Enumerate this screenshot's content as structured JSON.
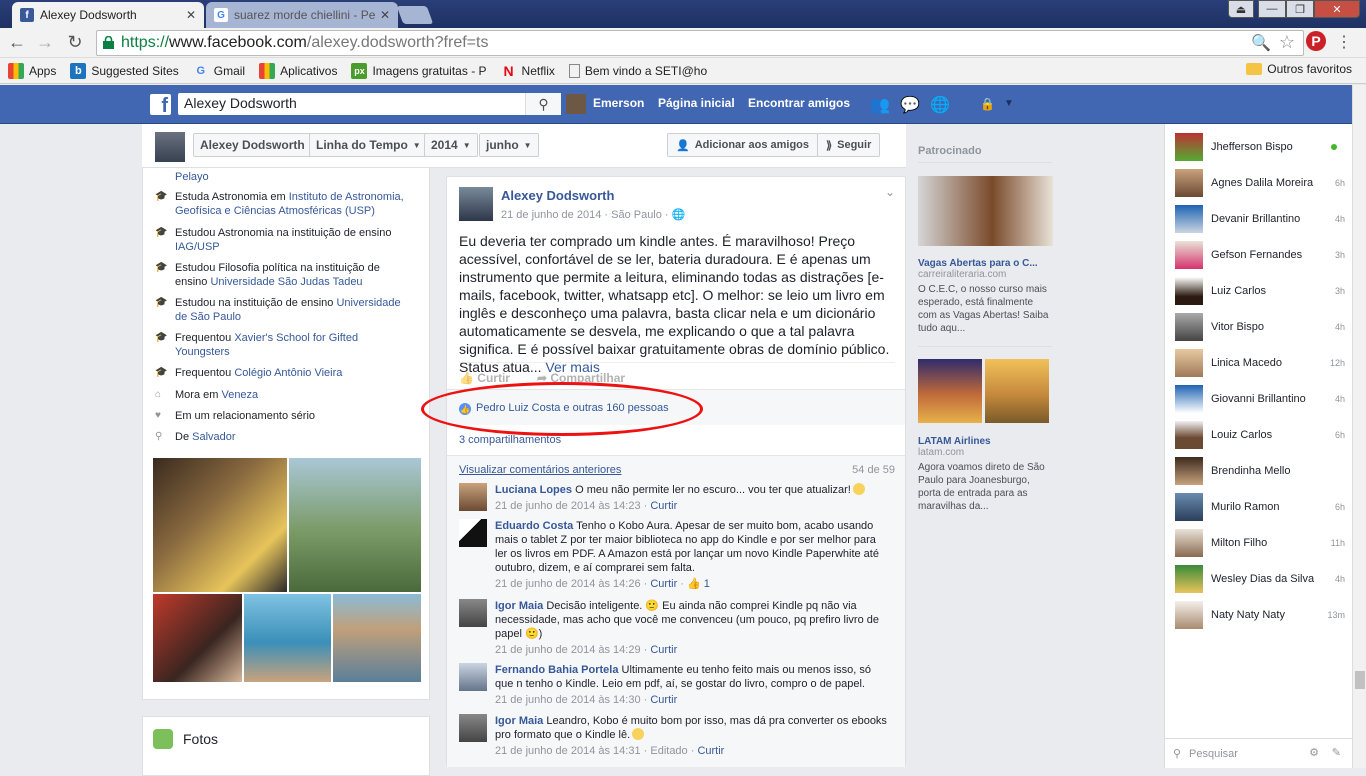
{
  "browser": {
    "tabs": [
      {
        "title": "Alexey Dodsworth",
        "active": true
      },
      {
        "title": "suarez morde chiellini - Pe",
        "active": false
      }
    ],
    "url_scheme": "https://",
    "url_domain": "www.facebook.com",
    "url_path": "/alexey.dodsworth?fref=ts",
    "bookmarks": [
      "Apps",
      "Suggested Sites",
      "Gmail",
      "Aplicativos",
      "Imagens gratuitas - P",
      "Netflix",
      "Bem vindo a SETI@ho"
    ],
    "other_bookmarks": "Outros favoritos"
  },
  "fb": {
    "search_value": "Alexey Dodsworth",
    "nav": {
      "user": "Emerson",
      "home": "Página inicial",
      "find_friends": "Encontrar amigos"
    }
  },
  "timeline_header": {
    "name": "Alexey Dodsworth",
    "timeline": "Linha do Tempo",
    "year": "2014",
    "month": "junho",
    "add_friend": "Adicionar aos amigos",
    "follow": "Seguir"
  },
  "intro": {
    "items": [
      {
        "prefix": "",
        "link": "Pelayo",
        "suffix": ""
      },
      {
        "prefix": "Estuda Astronomia em ",
        "link": "Instituto de Astronomia, Geofísica e Ciências Atmosféricas (USP)",
        "suffix": ""
      },
      {
        "prefix": "Estudou Astronomia na instituição de ensino ",
        "link": "IAG/USP",
        "suffix": ""
      },
      {
        "prefix": "Estudou Filosofia política na instituição de ensino ",
        "link": "Universidade São Judas Tadeu",
        "suffix": ""
      },
      {
        "prefix": "Estudou na instituição de ensino ",
        "link": "Universidade de São Paulo",
        "suffix": ""
      },
      {
        "prefix": "Frequentou ",
        "link": "Xavier's School for Gifted Youngsters",
        "suffix": ""
      },
      {
        "prefix": "Frequentou ",
        "link": "Colégio Antônio Vieira",
        "suffix": ""
      },
      {
        "prefix": "Mora em ",
        "link": "Veneza",
        "suffix": ""
      },
      {
        "prefix": "Em um relacionamento sério",
        "link": "",
        "suffix": ""
      },
      {
        "prefix": "De ",
        "link": "Salvador",
        "suffix": ""
      }
    ],
    "photos_title": "Fotos"
  },
  "post": {
    "author": "Alexey Dodsworth",
    "date": "21 de junho de 2014",
    "place": "São Paulo",
    "text": "Eu deveria ter comprado um kindle antes. É maravilhoso! Preço acessível, confortável de se ler, bateria duradoura. E é apenas um instrumento que permite a leitura, eliminando todas as distrações [e-mails, facebook, twitter, whatsapp etc]. O melhor: se leio um livro em inglês e desconheço uma palavra, basta clicar nela e um dicionário automaticamente se desvela, me explicando o que a tal palavra significa. E é possível baixar gratuitamente obras de domínio público. Status atua...",
    "see_more": "Ver mais",
    "like_label": "Curtir",
    "share_label": "Compartilhar",
    "likes_text": "Pedro Luiz Costa e outras 160 pessoas",
    "shares_text": "3 compartilhamentos",
    "view_previous": "Visualizar comentários anteriores",
    "comment_count": "54 de 59"
  },
  "comments": [
    {
      "name": "Luciana Lopes",
      "text": "O meu não permite ler no escuro... vou ter que atualizar!",
      "smile": true,
      "time": "21 de junho de 2014 às 14:23",
      "action": "Curtir",
      "likes": "",
      "edited": ""
    },
    {
      "name": "Eduardo Costa",
      "text": "Tenho o Kobo Aura. Apesar de ser muito bom, acabo usando mais o tablet Z por ter maior biblioteca no app do Kindle e por ser melhor para ler os livros em PDF. A Amazon está por lançar um novo Kindle Paperwhite até outubro, dizem, e aí comprarei sem falta.",
      "smile": false,
      "time": "21 de junho de 2014 às 14:26",
      "action": "Curtir",
      "likes": "1",
      "edited": ""
    },
    {
      "name": "Igor Maia",
      "text": "Decisão inteligente. 🙂 Eu ainda não comprei Kindle pq não via necessidade, mas acho que você me convenceu (um pouco, pq prefiro livro de papel 🙂)",
      "smile": false,
      "time": "21 de junho de 2014 às 14:29",
      "action": "Curtir",
      "likes": "",
      "edited": ""
    },
    {
      "name": "Fernando Bahia Portela",
      "text": "Ultimamente eu tenho feito mais ou menos isso, só que n tenho o Kindle. Leio em pdf, aí, se gostar do livro, compro o de papel.",
      "smile": false,
      "time": "21 de junho de 2014 às 14:30",
      "action": "Curtir",
      "likes": "",
      "edited": ""
    },
    {
      "name": "Igor Maia",
      "text": "Leandro, Kobo é muito bom por isso, mas dá pra converter os ebooks pro formato que o Kindle lê.",
      "smile": true,
      "time": "21 de junho de 2014 às 14:31",
      "action": "Curtir",
      "likes": "",
      "edited": "Editado"
    }
  ],
  "ads": {
    "label": "Patrocinado",
    "ad1": {
      "title": "Vagas Abertas para o C...",
      "domain": "carreiraliteraria.com",
      "text": "O C.E.C, o nosso curso mais esperado, está finalmente com as Vagas Abertas! Saiba tudo aqu..."
    },
    "ad2": {
      "title": "LATAM Airlines",
      "domain": "latam.com",
      "text": "Agora voamos direto de São Paulo para Joanesburgo, porta de entrada para as maravilhas da..."
    }
  },
  "chat": {
    "friends": [
      {
        "name": "Jhefferson Bispo",
        "time": "",
        "online": true
      },
      {
        "name": "Agnes Dalila Moreira",
        "time": "6h",
        "online": false
      },
      {
        "name": "Devanir Brillantino",
        "time": "4h",
        "online": false
      },
      {
        "name": "Gefson Fernandes",
        "time": "3h",
        "online": false
      },
      {
        "name": "Luiz Carlos",
        "time": "3h",
        "online": false
      },
      {
        "name": "Vitor Bispo",
        "time": "4h",
        "online": false
      },
      {
        "name": "Linica Macedo",
        "time": "12h",
        "online": false
      },
      {
        "name": "Giovanni Brillantino",
        "time": "4h",
        "online": false
      },
      {
        "name": "Louiz Carlos",
        "time": "6h",
        "online": false
      },
      {
        "name": "Brendinha Mello",
        "time": "",
        "online": false
      },
      {
        "name": "Murilo Ramon",
        "time": "6h",
        "online": false
      },
      {
        "name": "Milton Filho",
        "time": "11h",
        "online": false
      },
      {
        "name": "Wesley Dias da Silva",
        "time": "4h",
        "online": false
      },
      {
        "name": "Naty Naty Naty",
        "time": "13m",
        "online": false
      }
    ],
    "search_placeholder": "Pesquisar"
  }
}
